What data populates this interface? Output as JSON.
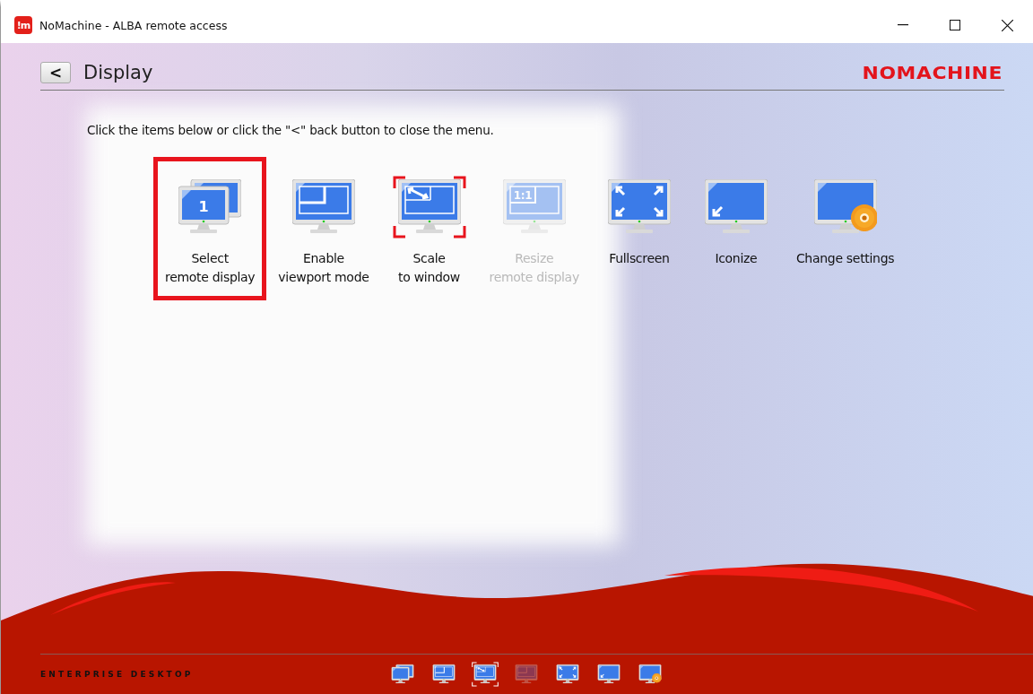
{
  "window": {
    "app_icon": "!m",
    "title": "NoMachine - ALBA remote access"
  },
  "header": {
    "back_button": "<",
    "title": "Display",
    "logo": "NOMACHINE"
  },
  "instruction": "Click the items below or click the \"<\" back button to close the menu.",
  "items": [
    {
      "kind": "multi",
      "badge": "1",
      "lines": [
        "Select",
        "remote display"
      ],
      "selected": true,
      "focused": false,
      "disabled": false
    },
    {
      "kind": "viewport",
      "lines": [
        "Enable",
        "viewport mode"
      ],
      "selected": false,
      "focused": false,
      "disabled": false
    },
    {
      "kind": "scale",
      "lines": [
        "Scale",
        "to window"
      ],
      "selected": false,
      "focused": true,
      "disabled": false
    },
    {
      "kind": "resize",
      "badge": "1:1",
      "lines": [
        "Resize",
        "remote display"
      ],
      "selected": false,
      "focused": false,
      "disabled": true
    },
    {
      "kind": "fullscreen",
      "lines": [
        "Fullscreen"
      ],
      "selected": false,
      "focused": false,
      "disabled": false
    },
    {
      "kind": "iconize",
      "lines": [
        "Iconize"
      ],
      "selected": false,
      "focused": false,
      "disabled": false
    },
    {
      "kind": "settings",
      "lines": [
        "Change settings"
      ],
      "selected": false,
      "focused": false,
      "disabled": false
    }
  ],
  "footer": {
    "edition": "ENTERPRISE DESKTOP"
  }
}
